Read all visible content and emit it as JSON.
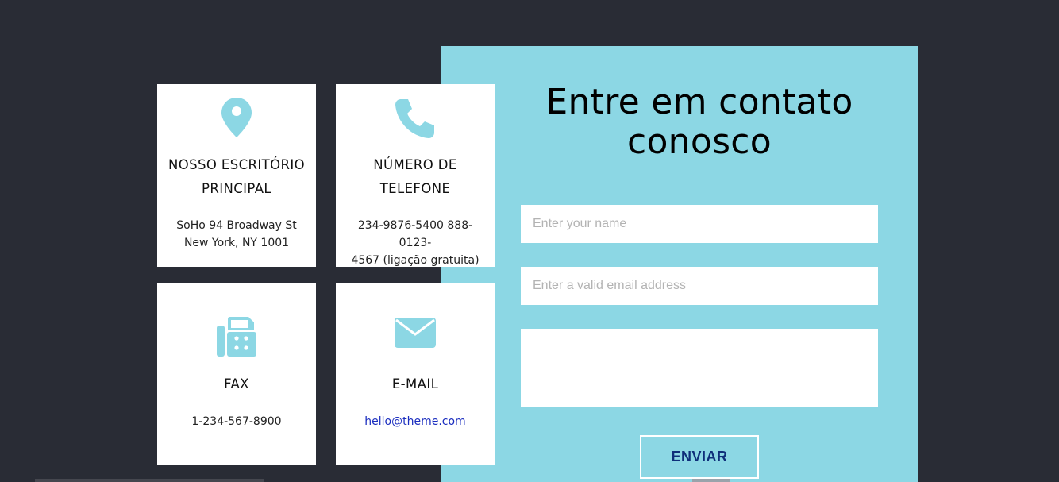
{
  "contact_cards": {
    "office": {
      "icon": "map-pin-icon",
      "heading": "NOSSO ESCRITÓRIO PRINCIPAL",
      "line1": "SoHo 94 Broadway St",
      "line2": "New York, NY 1001"
    },
    "phone": {
      "icon": "phone-icon",
      "heading": "NÚMERO DE TELEFONE",
      "line1": "234-9876-5400 888-0123-",
      "line2": "4567 (ligação gratuita)"
    },
    "fax": {
      "icon": "fax-icon",
      "heading": "FAX",
      "line1": "1-234-567-8900"
    },
    "email": {
      "icon": "envelope-icon",
      "heading": "E-MAIL",
      "link": "hello@theme.com"
    }
  },
  "form": {
    "title": "Entre em contato conosco",
    "name_placeholder": "Enter your name",
    "email_placeholder": "Enter a valid email address",
    "message_placeholder": "",
    "submit_label": "ENVIAR"
  },
  "colors": {
    "background": "#292c35",
    "accent": "#8cd7e4",
    "card": "#ffffff",
    "button_text": "#0f2f7a"
  }
}
